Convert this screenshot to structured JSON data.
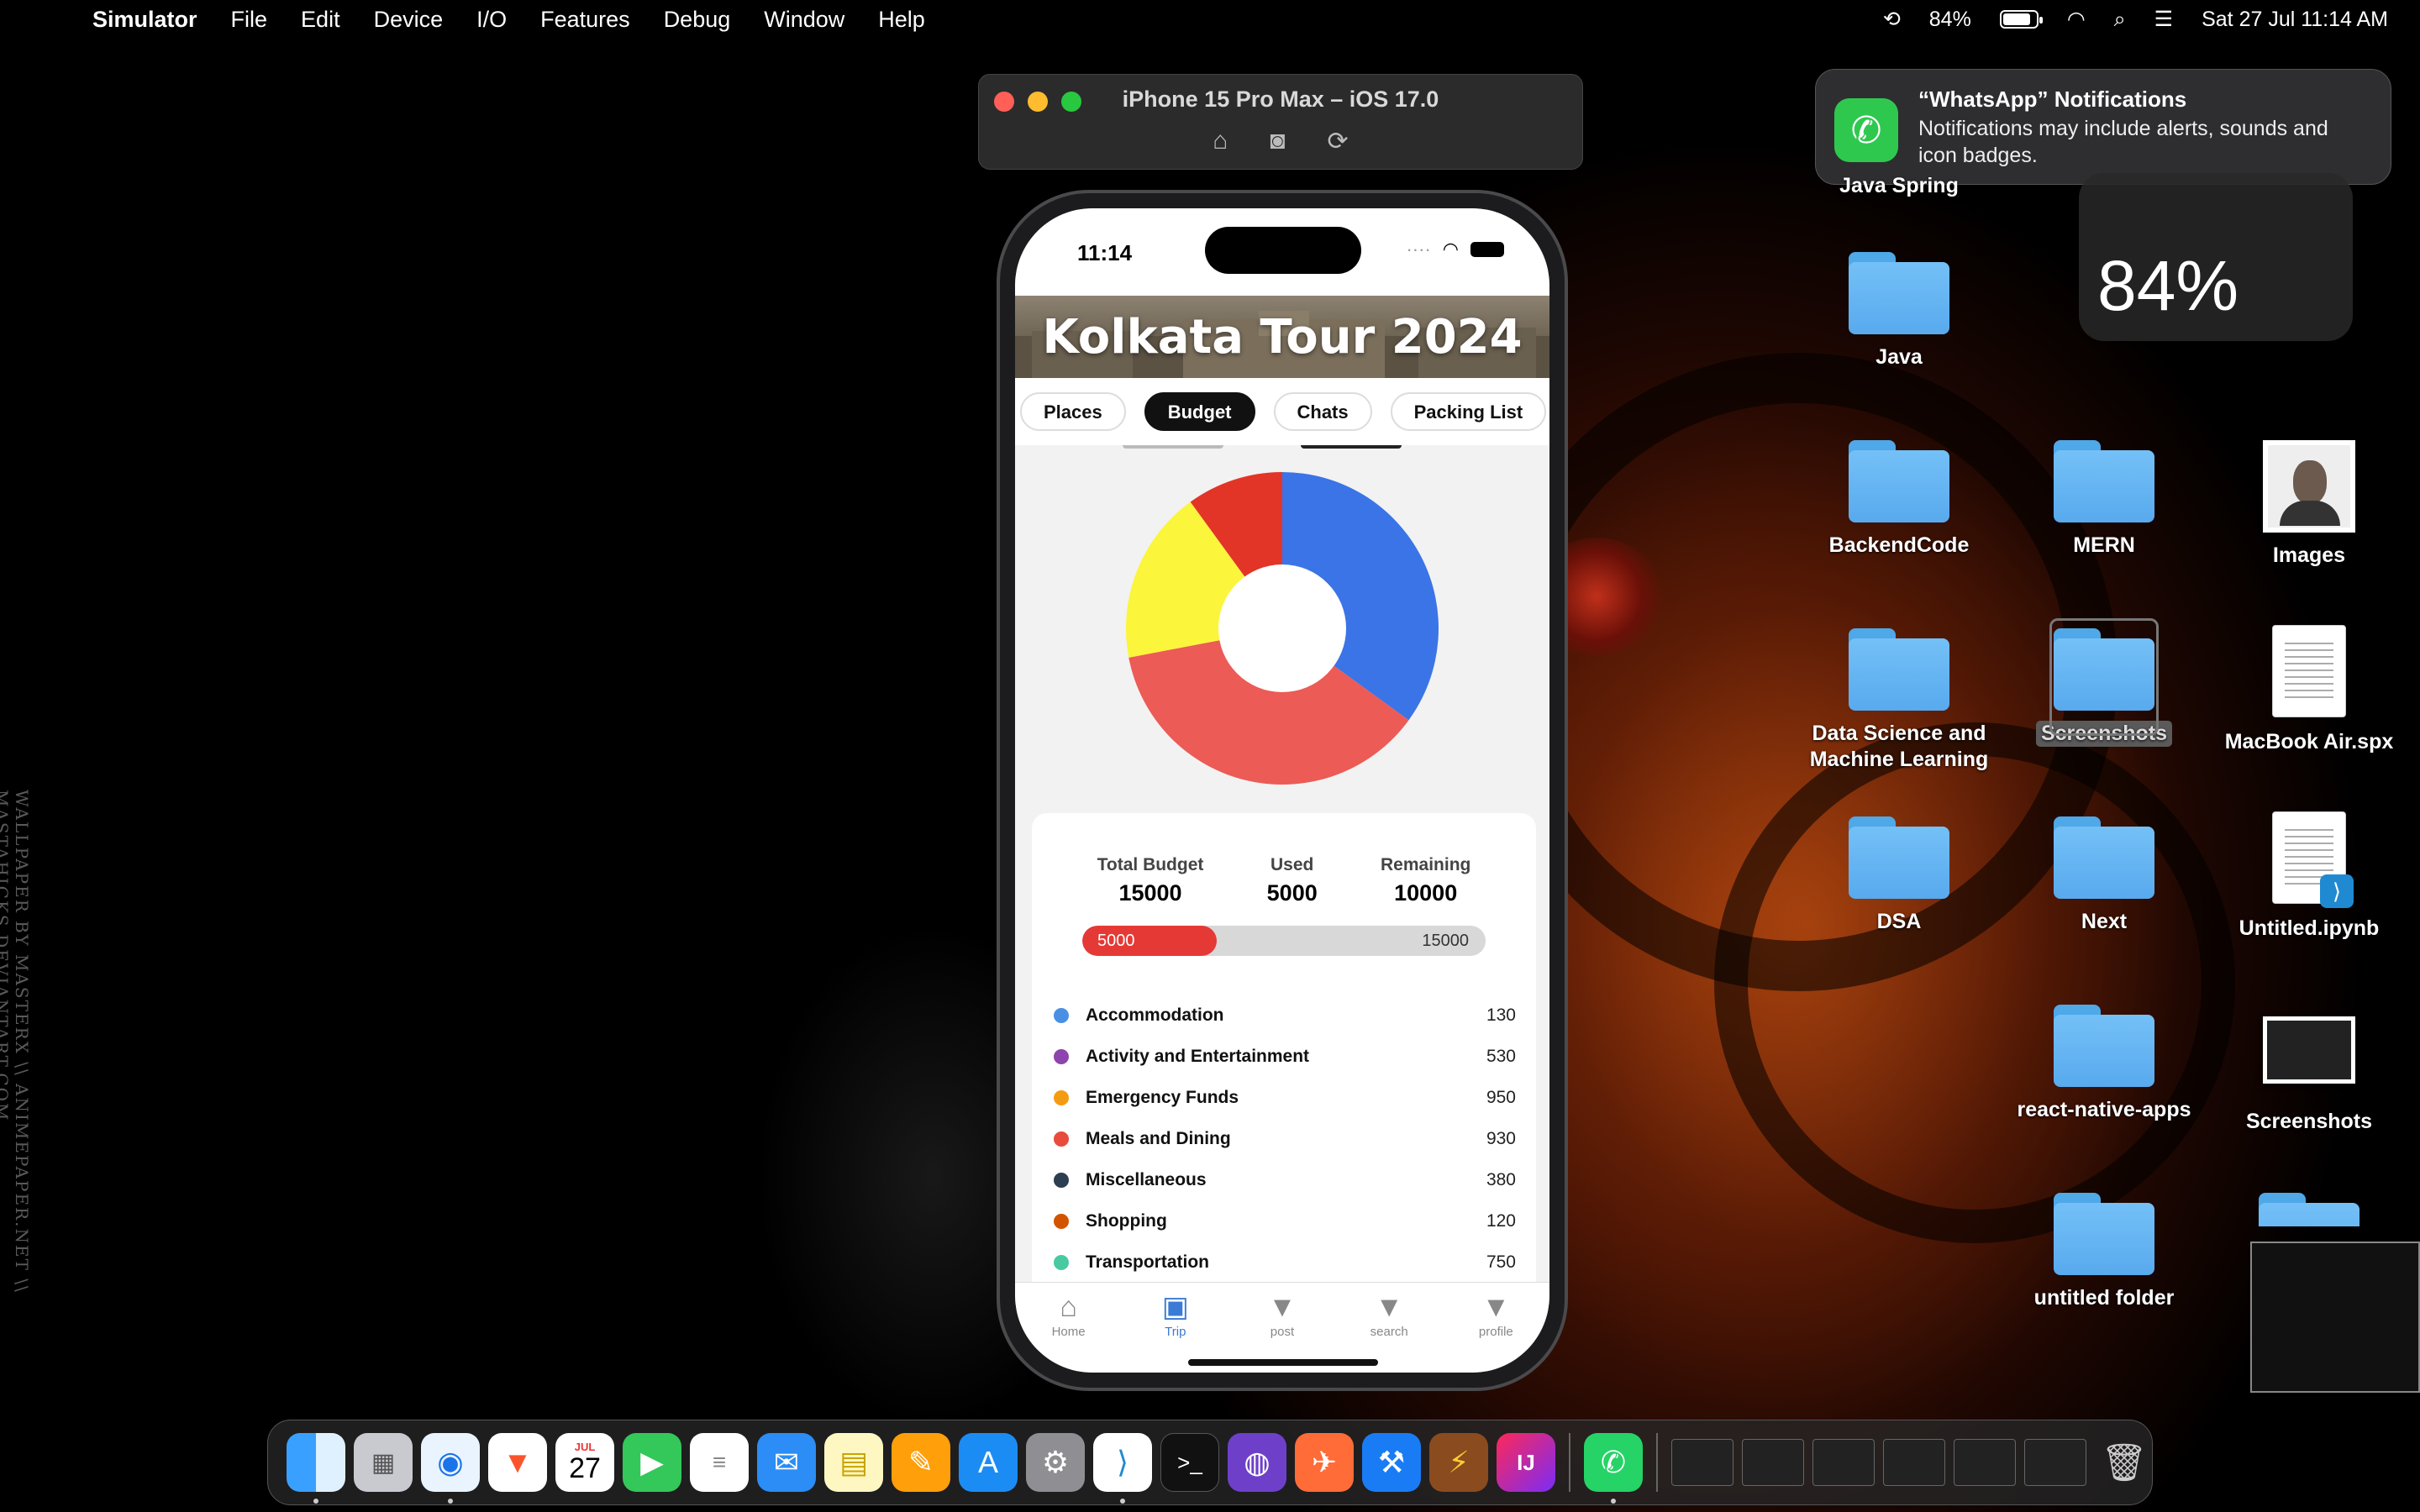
{
  "menubar": {
    "app_name": "Simulator",
    "items": [
      "File",
      "Edit",
      "Device",
      "I/O",
      "Features",
      "Debug",
      "Window",
      "Help"
    ],
    "battery_percent": "84%",
    "battery_level": 0.84,
    "datetime": "Sat 27 Jul  11:14 AM"
  },
  "simulator": {
    "title": "iPhone 15 Pro Max – iOS 17.0"
  },
  "phone": {
    "time": "11:14",
    "banner_title": "Kolkata Tour 2024",
    "tabs": [
      {
        "label": "Places",
        "active": false
      },
      {
        "label": "Budget",
        "active": true
      },
      {
        "label": "Chats",
        "active": false
      },
      {
        "label": "Packing List",
        "active": false
      }
    ],
    "chart_data": {
      "type": "pie",
      "donut": true,
      "categories": [
        "Blue",
        "Coral",
        "Yellow",
        "Red"
      ],
      "values": [
        35,
        37,
        18,
        10
      ],
      "colors": [
        "#3b74e6",
        "#ec5b56",
        "#fbf53c",
        "#e23527"
      ]
    },
    "budget": {
      "total_label": "Total Budget",
      "total_value": "15000",
      "used_label": "Used",
      "used_value": "5000",
      "remaining_label": "Remaining",
      "remaining_value": "10000",
      "progress_low": "5000",
      "progress_high": "15000",
      "progress_fraction": 0.333
    },
    "categories": [
      {
        "name": "Accommodation",
        "amount": "130",
        "color": "#4a90e2"
      },
      {
        "name": "Activity and Entertainment",
        "amount": "530",
        "color": "#8e44ad"
      },
      {
        "name": "Emergency Funds",
        "amount": "950",
        "color": "#f39c12"
      },
      {
        "name": "Meals and Dining",
        "amount": "930",
        "color": "#e74c3c"
      },
      {
        "name": "Miscellaneous",
        "amount": "380",
        "color": "#2c3e50"
      },
      {
        "name": "Shopping",
        "amount": "120",
        "color": "#d35400"
      },
      {
        "name": "Transportation",
        "amount": "750",
        "color": "#48c9a0"
      }
    ],
    "tabbar": [
      {
        "label": "Home",
        "icon": "home-icon",
        "active": false
      },
      {
        "label": "Trip",
        "icon": "train-icon",
        "active": true
      },
      {
        "label": "post",
        "icon": "triangle-down-icon",
        "active": false
      },
      {
        "label": "search",
        "icon": "triangle-down-icon",
        "active": false
      },
      {
        "label": "profile",
        "icon": "triangle-down-icon",
        "active": false
      }
    ]
  },
  "notification": {
    "title": "“WhatsApp” Notifications",
    "body": "Notifications may include alerts, sounds and icon badges."
  },
  "widget": {
    "percent": "84%"
  },
  "desktop": {
    "java_spring": "Java Spring",
    "java": "Java",
    "backend": "BackendCode",
    "mern": "MERN",
    "images": "Images",
    "datascience": "Data Science and Machine Learning",
    "screenshots_folder": "Screenshots",
    "macbook": "MacBook Air.spx",
    "dsa": "DSA",
    "next": "Next",
    "untitled_ipynb": "Untitled.ipynb",
    "react_native": "react-native-apps",
    "screenshots_file": "Screenshots",
    "untitled_folder": "untitled folder"
  },
  "dock": {
    "calendar_month": "JUL",
    "calendar_day": "27"
  },
  "wallpaper_credit": "WALLPAPER BY MASTERX \\\\ ANIMEPAPER.NET \\\\ MASTAHICKS.DEVIANTART.COM"
}
